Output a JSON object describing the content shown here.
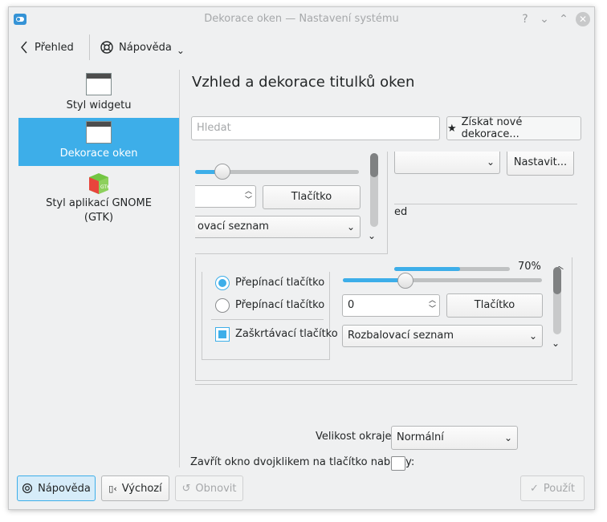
{
  "window": {
    "title": "Dekorace oken  — Nastavení systému",
    "controls": [
      "?",
      "⌄",
      "⌃",
      "✕"
    ]
  },
  "toolbar": {
    "back_label": "Přehled",
    "help_label": "Nápověda"
  },
  "sidebar": {
    "items": [
      {
        "label": "Styl widgetu",
        "icon": "window-icon"
      },
      {
        "label": "Dekorace oken",
        "icon": "window-icon"
      },
      {
        "label": "Styl aplikací GNOME\n(GTK)",
        "icon": "gtk-icon"
      }
    ]
  },
  "main": {
    "title": "Vzhled a dekorace titulků oken",
    "search_placeholder": "Hledat",
    "get_button": "Získat nové dekorace...",
    "configure_button": "Nastavit...",
    "preview": {
      "button_label": "Tlačítko",
      "combo_label_partial": "ovací seznam",
      "partial_text": "ed",
      "progress_label": "70%",
      "progress_value": 0.7,
      "radio1": "Přepínací tlačítko",
      "radio2": "Přepínací tlačítko",
      "checkbox": "Zaškrtávací tlačítko",
      "spin_value": "0",
      "combo_label": "Rozbalovací seznam",
      "slider_value": 0.3
    },
    "border_size_label": "Velikost okraje:",
    "border_size_value": "Normální",
    "close_label": "Zavřít okno dvojklikem na tlačítko nabídky:"
  },
  "footer": {
    "help": "Nápověda",
    "defaults": "Výchozí",
    "reset": "Obnovit",
    "apply": "Použít"
  },
  "colors": {
    "accent": "#3daee9",
    "window_bg": "#eff0f1"
  }
}
